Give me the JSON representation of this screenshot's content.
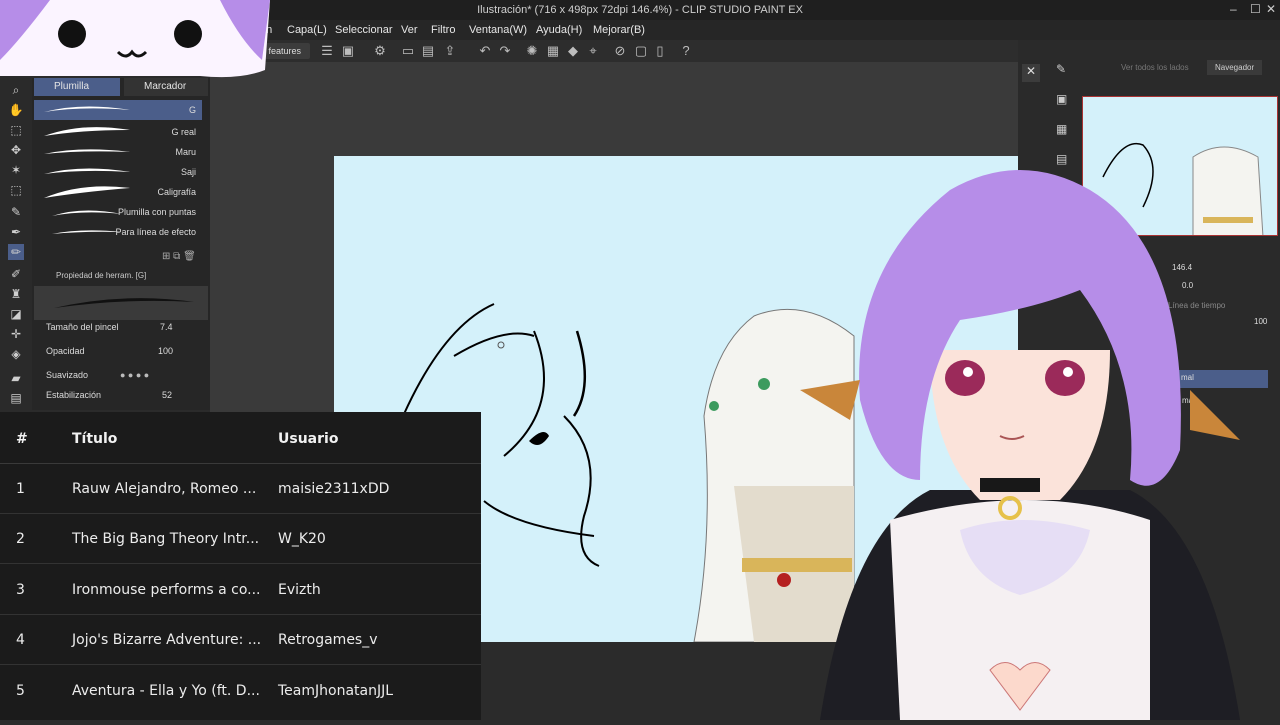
{
  "window": {
    "title": "Ilustración* (716 x 498px 72dpi 146.4%) - CLIP STUDIO PAINT EX",
    "controls": [
      "–",
      "☐",
      "✕"
    ]
  },
  "menu": {
    "items": [
      "ación",
      "Capa(L)",
      "Seleccionar",
      "Ver",
      "Filtro",
      "Ventana(W)",
      "Ayuda(H)",
      "Mejorar(B)"
    ]
  },
  "commandbar": {
    "features_label": "ble features"
  },
  "subtool": {
    "tabs": [
      "Plumilla",
      "Marcador"
    ],
    "brushes": [
      {
        "label": "G"
      },
      {
        "label": "G real"
      },
      {
        "label": "Maru"
      },
      {
        "label": "Saji"
      },
      {
        "label": "Caligrafía"
      },
      {
        "label": "Plumilla con puntas"
      },
      {
        "label": "Para línea de efecto"
      }
    ]
  },
  "toolprop": {
    "title": "Propiedad de herram. [G]",
    "brush_size_label": "Tamaño del pincel",
    "brush_size_value": "7.4",
    "opacity_label": "Opacidad",
    "opacity_value": "100",
    "smoothing_label": "Suavizado",
    "stabilization_label": "Estabilización",
    "stabilization_value": "52"
  },
  "navigator": {
    "tab_all": "Ver todos los lados",
    "tab_nav": "Navegador",
    "zoom": "146.4",
    "rotation": "0.0"
  },
  "layers": {
    "timeline_label": "Línea de tiempo",
    "opacity_value": "100",
    "blend_1": "mal",
    "blend_2": "mal"
  },
  "ranking": {
    "headers": {
      "num": "#",
      "title": "Título",
      "user": "Usuario"
    },
    "rows": [
      {
        "num": "1",
        "title": "Rauw Alejandro, Romeo ...",
        "user": "maisie2311xDD"
      },
      {
        "num": "2",
        "title": "The Big Bang Theory Intr...",
        "user": "W_K20"
      },
      {
        "num": "3",
        "title": "Ironmouse performs a co...",
        "user": "Evizth"
      },
      {
        "num": "4",
        "title": "Jojo's Bizarre Adventure: ...",
        "user": "Retrogames_v"
      },
      {
        "num": "5",
        "title": "Aventura - Ella y Yo (ft. D...",
        "user": "TeamJhonatanJJL"
      }
    ]
  },
  "colors": {
    "canvas_bg": "#d4f1fa",
    "panel_bg": "#262626",
    "table_bg": "#1b1b1b",
    "hair_purple": "#b68de8",
    "accent_selection": "#4b5e8a"
  }
}
